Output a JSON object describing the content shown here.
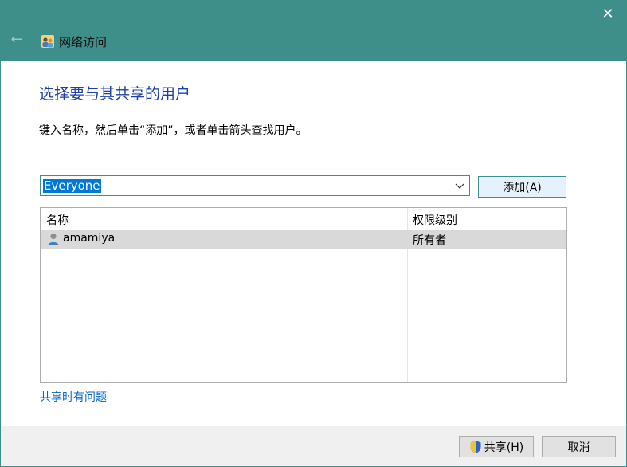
{
  "window": {
    "title": "网络访问",
    "close_glyph": "✕",
    "back_glyph": "←"
  },
  "heading": "选择要与其共享的用户",
  "instruction": "键入名称，然后单击“添加”，或者单击箭头查找用户。",
  "combo": {
    "value": "Everyone"
  },
  "add_button": "添加(A)",
  "list": {
    "columns": [
      "名称",
      "权限级别"
    ],
    "rows": [
      {
        "name": "amamiya",
        "permission": "所有者"
      }
    ]
  },
  "help_link": "共享时有问题",
  "footer": {
    "share_button": "共享(H)",
    "cancel_button": "取消"
  },
  "colors": {
    "titlebar": "#3e8e8a",
    "heading": "#1c3fa8",
    "selection": "#0078d7",
    "link": "#0066cc"
  }
}
